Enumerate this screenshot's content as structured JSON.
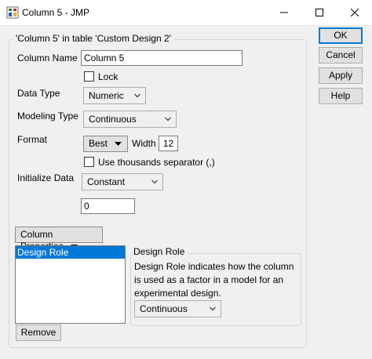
{
  "window": {
    "title": "Column 5 - JMP",
    "app_icon": "jmp-app-icon",
    "controls": [
      "minimize-icon",
      "maximize-icon",
      "close-icon"
    ]
  },
  "group_title": "'Column 5' in table 'Custom Design 2'",
  "column_name": {
    "label": "Column Name",
    "value": "Column 5"
  },
  "lock": {
    "label": "Lock",
    "checked": false
  },
  "data_type": {
    "label": "Data Type",
    "selected": "Numeric"
  },
  "modeling_type": {
    "label": "Modeling Type",
    "selected": "Continuous"
  },
  "format": {
    "label": "Format",
    "button_label": "Best",
    "width_label": "Width",
    "width_value": "12"
  },
  "thousands": {
    "label": "Use thousands separator (,)",
    "checked": false
  },
  "initialize": {
    "label": "Initialize Data",
    "selected": "Constant",
    "value": "0"
  },
  "column_properties": {
    "button_label": "Column Properties",
    "items": [
      "Design Role"
    ],
    "remove_label": "Remove"
  },
  "design_role": {
    "title": "Design Role",
    "description": "Design Role indicates how the column is used as a factor in a model for an experimental design.",
    "selected": "Continuous"
  },
  "side_buttons": {
    "ok": "OK",
    "cancel": "Cancel",
    "apply": "Apply",
    "help": "Help"
  },
  "colors": {
    "selection": "#0078d7",
    "dialog_bg": "#f0f0f0"
  }
}
